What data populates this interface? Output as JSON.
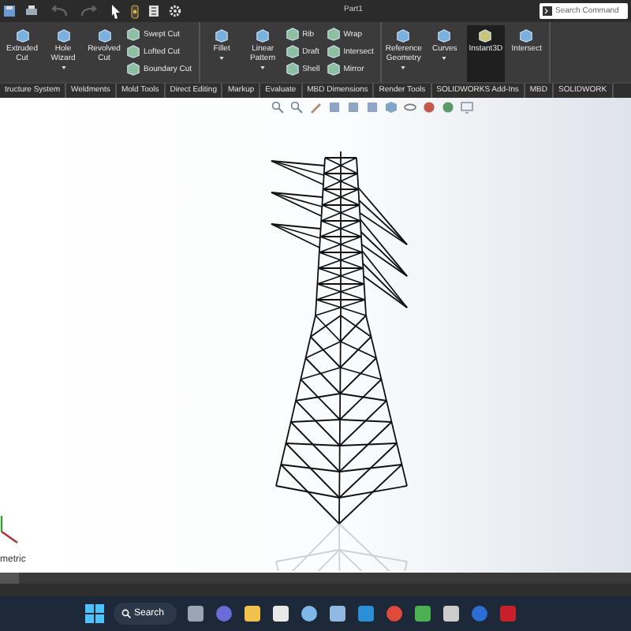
{
  "window": {
    "title": "Part1"
  },
  "search": {
    "placeholder": "Search Command"
  },
  "ribbon": [
    {
      "items": [
        {
          "kind": "large",
          "label": "Extruded Cut",
          "caret": false,
          "active": false
        },
        {
          "kind": "large",
          "label": "Hole Wizard",
          "caret": true,
          "active": false
        },
        {
          "kind": "large",
          "label": "Revolved Cut",
          "caret": false,
          "active": false
        },
        {
          "kind": "stack",
          "labels": [
            "Swept Cut",
            "Lofted Cut",
            "Boundary Cut"
          ]
        }
      ]
    },
    {
      "items": [
        {
          "kind": "large",
          "label": "Fillet",
          "caret": true,
          "active": false
        },
        {
          "kind": "large",
          "label": "Linear Pattern",
          "caret": true,
          "active": false
        },
        {
          "kind": "stack",
          "labels": [
            "Rib",
            "Draft",
            "Shell"
          ]
        },
        {
          "kind": "stack",
          "labels": [
            "Wrap",
            "Intersect",
            "Mirror"
          ]
        }
      ]
    },
    {
      "items": [
        {
          "kind": "large",
          "label": "Reference Geometry",
          "caret": true,
          "active": false
        },
        {
          "kind": "large",
          "label": "Curves",
          "caret": true,
          "active": false
        },
        {
          "kind": "large",
          "label": "Instant3D",
          "caret": false,
          "active": true
        },
        {
          "kind": "large",
          "label": "Intersect",
          "caret": false,
          "active": false
        }
      ]
    }
  ],
  "tabs": [
    "tructure System",
    "Weldments",
    "Mold Tools",
    "Direct Editing",
    "Markup",
    "Evaluate",
    "MBD Dimensions",
    "Render Tools",
    "SOLIDWORKS Add-Ins",
    "MBD",
    "SOLIDWORK"
  ],
  "viewport": {
    "view_label": "metric"
  },
  "taskbar": {
    "search_label": "Search"
  }
}
